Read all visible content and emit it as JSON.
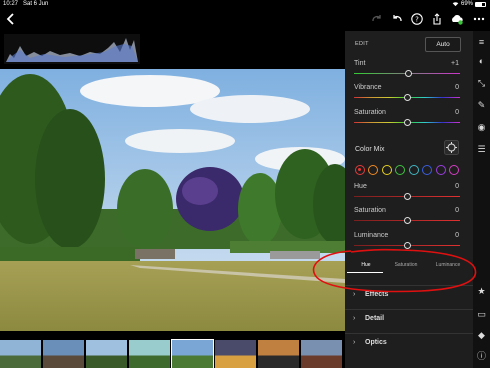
{
  "status": {
    "time": "10:27",
    "date": "Sat 6 Jun",
    "battery": "69%",
    "battery_level": 0.69
  },
  "topbar": {
    "icons": [
      "chevron-left-icon",
      "redo-icon",
      "undo-icon",
      "help-icon",
      "share-icon",
      "cloud-sync-icon",
      "more-icon"
    ]
  },
  "panel": {
    "edit_label": "EDIT",
    "auto_label": "Auto",
    "sliders_top": [
      {
        "label": "Tint",
        "value": "+1",
        "position": 0.51,
        "track": "tint"
      },
      {
        "label": "Vibrance",
        "value": "0",
        "position": 0.5,
        "track": "rainbow"
      },
      {
        "label": "Saturation",
        "value": "0",
        "position": 0.5,
        "track": "rainbow"
      }
    ],
    "color_mix": {
      "label": "Color Mix",
      "swatches": [
        "#e33b3b",
        "#f08a24",
        "#e8d21d",
        "#3fc43f",
        "#3fb8c4",
        "#3a5ee0",
        "#9a3ee0",
        "#d63ec4"
      ],
      "selected_index": 0,
      "sliders": [
        {
          "label": "Hue",
          "value": "0",
          "position": 0.5
        },
        {
          "label": "Saturation",
          "value": "0",
          "position": 0.5
        },
        {
          "label": "Luminance",
          "value": "0",
          "position": 0.5
        }
      ],
      "tabs": [
        "Hue",
        "Saturation",
        "Luminance"
      ],
      "active_tab": 0
    },
    "sections": [
      "Effects",
      "Detail",
      "Optics"
    ]
  },
  "rail": {
    "icons": [
      "sliders-icon",
      "presets-icon",
      "crop-icon",
      "healing-icon",
      "selective-icon",
      "profile-icon",
      "star-icon",
      "comment-icon",
      "tag-icon",
      "info-icon"
    ]
  },
  "colors": {
    "panel_bg": "#1e1e1e",
    "annotation": "#e01010"
  }
}
